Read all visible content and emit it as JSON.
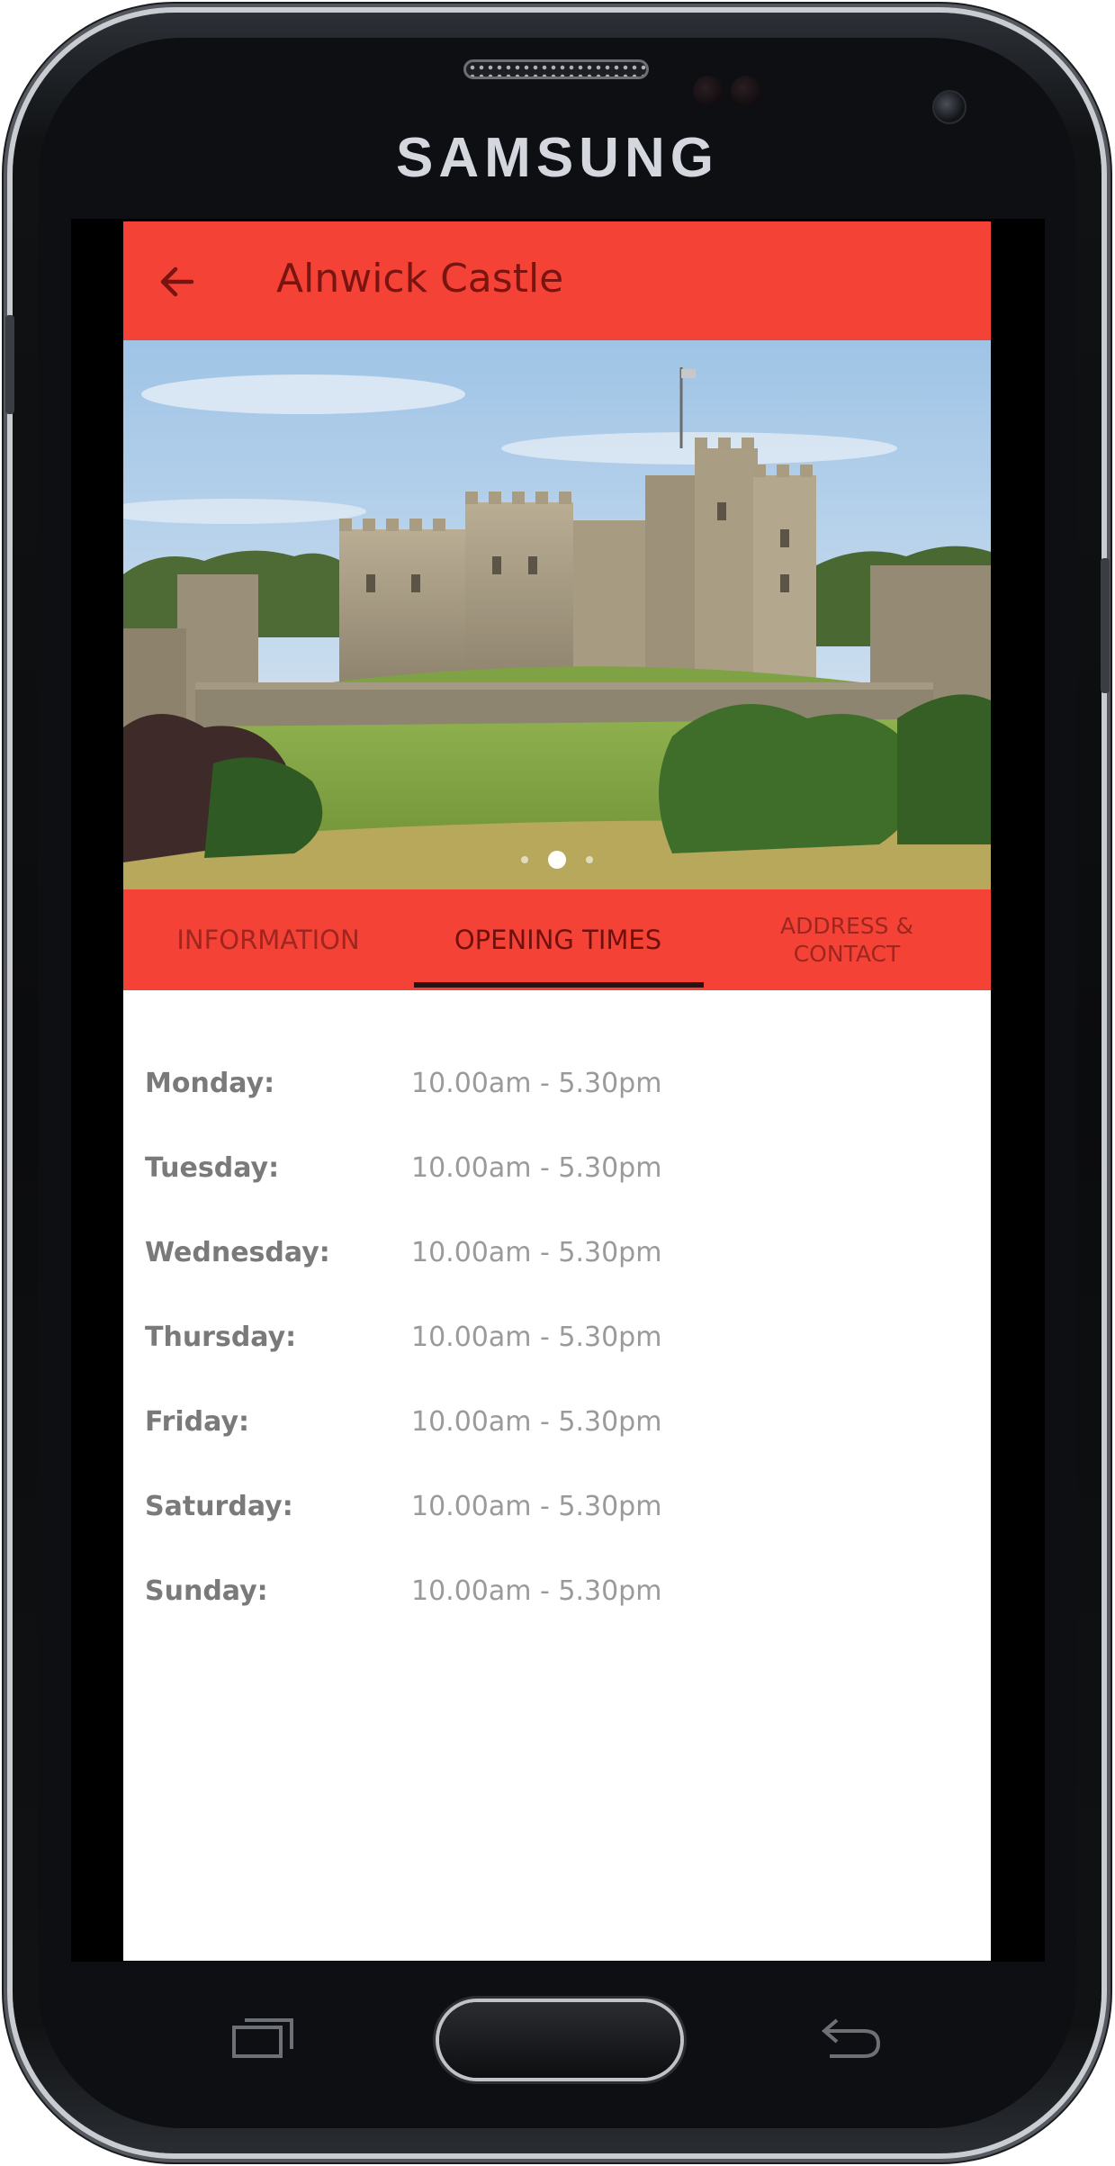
{
  "device": {
    "brand": "SAMSUNG"
  },
  "app_bar": {
    "title": "Alnwick Castle",
    "back_icon": "arrow-left-icon",
    "color": "#f44336"
  },
  "hero": {
    "carousel_dots": 3,
    "active_dot_index": 1
  },
  "tabs": [
    {
      "label": "INFORMATION",
      "selected": false
    },
    {
      "label": "OPENING TIMES",
      "selected": true
    },
    {
      "label": "ADDRESS & CONTACT",
      "line1": "ADDRESS &",
      "line2": "CONTACT",
      "selected": false
    }
  ],
  "opening_times": [
    {
      "day": "Monday:",
      "hours": "10.00am - 5.30pm"
    },
    {
      "day": "Tuesday:",
      "hours": "10.00am - 5.30pm"
    },
    {
      "day": "Wednesday:",
      "hours": "10.00am - 5.30pm"
    },
    {
      "day": "Thursday:",
      "hours": "10.00am - 5.30pm"
    },
    {
      "day": "Friday:",
      "hours": "10.00am - 5.30pm"
    },
    {
      "day": "Saturday:",
      "hours": "10.00am - 5.30pm"
    },
    {
      "day": "Sunday:",
      "hours": "10.00am - 5.30pm"
    }
  ],
  "nav_buttons": {
    "recent": "recent-apps-icon",
    "home": "home-button",
    "back": "back-arrow-icon"
  }
}
